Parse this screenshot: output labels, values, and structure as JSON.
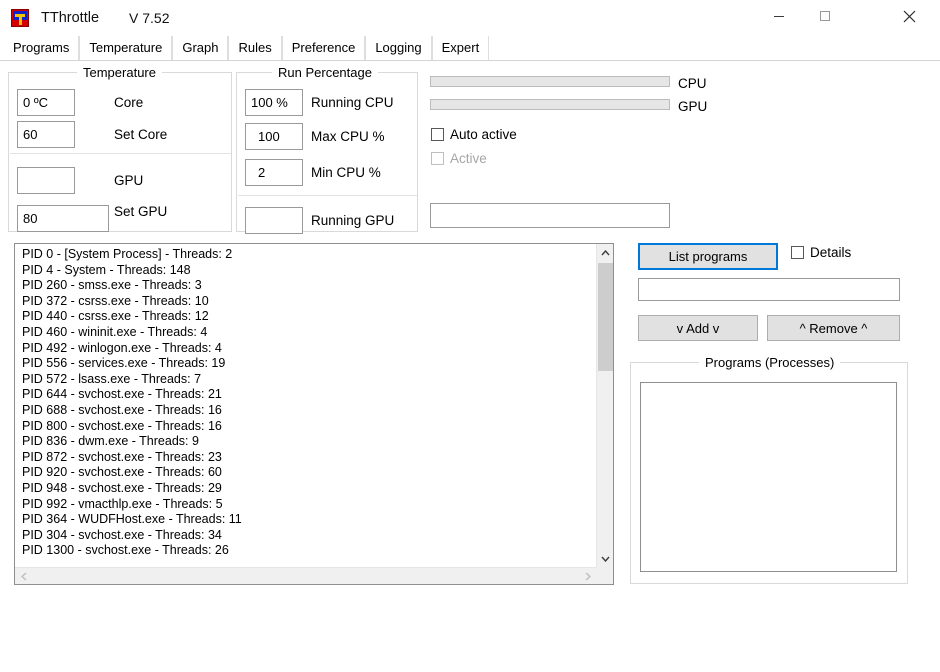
{
  "window": {
    "title": "TThrottle",
    "version": "V 7.52",
    "controls": {
      "minimize": "minimize-button",
      "maximize": "maximize-button",
      "close": "close-button"
    }
  },
  "tabs": [
    {
      "label": "Programs",
      "active": true
    },
    {
      "label": "Temperature",
      "active": false
    },
    {
      "label": "Graph",
      "active": false
    },
    {
      "label": "Rules",
      "active": false
    },
    {
      "label": "Preference",
      "active": false
    },
    {
      "label": "Logging",
      "active": false
    },
    {
      "label": "Expert",
      "active": false
    }
  ],
  "temperature_group": {
    "title": "Temperature",
    "core_value": "0 ºC",
    "core_label": "Core",
    "set_core_value": "60",
    "set_core_label": "Set Core",
    "gpu_value": "",
    "gpu_label": "GPU",
    "set_gpu_value": "80",
    "set_gpu_label": "Set GPU"
  },
  "run_percentage_group": {
    "title": "Run Percentage",
    "running_cpu_value": "100 %",
    "running_cpu_label": "Running CPU",
    "max_cpu_value": "100",
    "max_cpu_label": "Max CPU %",
    "min_cpu_value": "2",
    "min_cpu_label": "Min CPU %",
    "running_gpu_value": "",
    "running_gpu_label": "Running GPU"
  },
  "status_panel": {
    "cpu_label": "CPU",
    "gpu_label": "GPU",
    "cpu_progress": 0,
    "gpu_progress": 0,
    "auto_active_label": "Auto active",
    "auto_active_checked": false,
    "active_label": "Active",
    "active_checked": false,
    "active_enabled": false,
    "status_field_value": ""
  },
  "process_list": {
    "lines": [
      "PID 0 - [System Process] - Threads: 2",
      "PID 4 - System - Threads: 148",
      "PID 260 - smss.exe - Threads: 3",
      "PID 372 - csrss.exe - Threads: 10",
      "PID 440 - csrss.exe - Threads: 12",
      "PID 460 - wininit.exe - Threads: 4",
      "PID 492 - winlogon.exe - Threads: 4",
      "PID 556 - services.exe - Threads: 19",
      "PID 572 - lsass.exe - Threads: 7",
      "PID 644 - svchost.exe - Threads: 21",
      "PID 688 - svchost.exe - Threads: 16",
      "PID 800 - svchost.exe - Threads: 16",
      "PID 836 - dwm.exe - Threads: 9",
      "PID 872 - svchost.exe - Threads: 23",
      "PID 920 - svchost.exe - Threads: 60",
      "PID 948 - svchost.exe - Threads: 29",
      "PID 992 - vmacthlp.exe - Threads: 5",
      "PID 364 - WUDFHost.exe - Threads: 11",
      "PID 304 - svchost.exe - Threads: 34",
      "PID 1300 - svchost.exe - Threads: 26"
    ]
  },
  "right_panel": {
    "list_programs_label": "List programs",
    "details_label": "Details",
    "details_checked": false,
    "filter_value": "",
    "add_label": "v Add v",
    "remove_label": "^ Remove ^",
    "programs_group_title": "Programs (Processes)",
    "programs_items": []
  },
  "colors": {
    "accent": "#0078d7",
    "button_face": "#e1e1e1",
    "progress_track": "#e6e6e6",
    "scrollbar_thumb": "#cdcdcd",
    "window_bg": "#ffffff"
  }
}
